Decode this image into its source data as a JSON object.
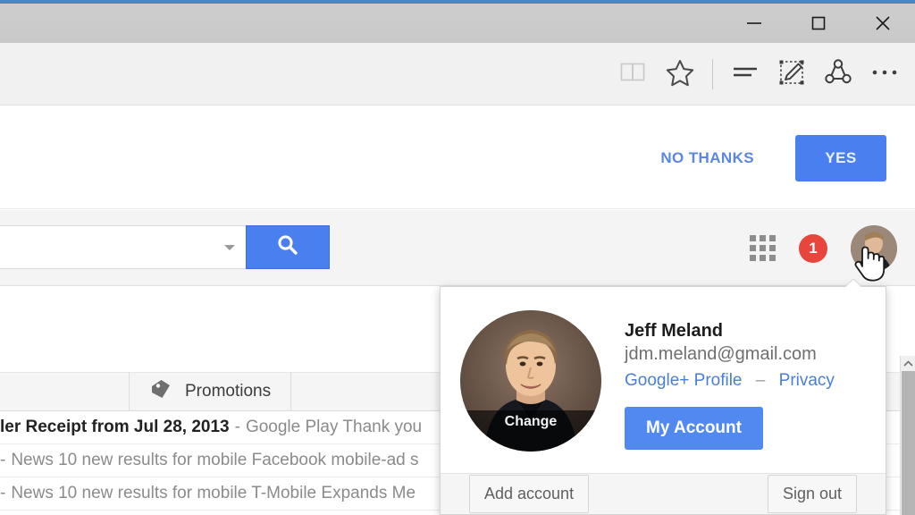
{
  "window": {
    "controls": [
      {
        "name": "minimize",
        "glyph": "minimize-icon"
      },
      {
        "name": "maximize",
        "glyph": "maximize-icon"
      },
      {
        "name": "close",
        "glyph": "close-icon"
      }
    ],
    "accent_color": "#4a87c8",
    "titlebar_color": "#c9c9c9"
  },
  "browser_toolbar": {
    "icons": [
      {
        "name": "reading-view-icon",
        "title": "Reading view"
      },
      {
        "name": "favorites-star-icon",
        "title": "Add to favorites"
      },
      {
        "name": "hub-icon",
        "title": "Hub"
      },
      {
        "name": "web-note-icon",
        "title": "Make a Web Note"
      },
      {
        "name": "share-icon",
        "title": "Share"
      },
      {
        "name": "more-icon",
        "title": "More"
      }
    ]
  },
  "notification_bar": {
    "no_thanks_label": "NO THANKS",
    "yes_label": "YES",
    "primary_color": "#4a7ff0",
    "link_color": "#5b87e0"
  },
  "gmail_header": {
    "search": {
      "value": "",
      "placeholder": ""
    },
    "search_icon": "search-icon",
    "apps_icon": "apps-grid-icon",
    "notification_count": "1",
    "notification_color": "#e8453c",
    "avatar": "user-avatar"
  },
  "mail": {
    "tabs": [
      {
        "label": "Promotions",
        "icon": "tag-icon"
      }
    ],
    "rows": [
      {
        "subject": "ler Receipt from Jul 28, 2013",
        "separator": "-",
        "snippet": "Google Play Thank you",
        "bold": true
      },
      {
        "subject": "",
        "separator": "-",
        "snippet": "News 10 new results for mobile Facebook mobile-ad s",
        "bold": false
      },
      {
        "subject": "",
        "separator": "-",
        "snippet": "News 10 new results for mobile T-Mobile Expands Me",
        "bold": false
      }
    ]
  },
  "scrollbar": {
    "up_arrow": "chevron-up-icon"
  },
  "account_popup": {
    "name": "Jeff Meland",
    "email": "jdm.meland@gmail.com",
    "photo_change_label": "Change",
    "links": [
      {
        "label": "Google+ Profile"
      },
      {
        "label": "Privacy"
      }
    ],
    "link_separator": "–",
    "my_account_label": "My Account",
    "add_account_label": "Add account",
    "sign_out_label": "Sign out",
    "button_color": "#5289f0",
    "link_color": "#4a7fd4"
  }
}
